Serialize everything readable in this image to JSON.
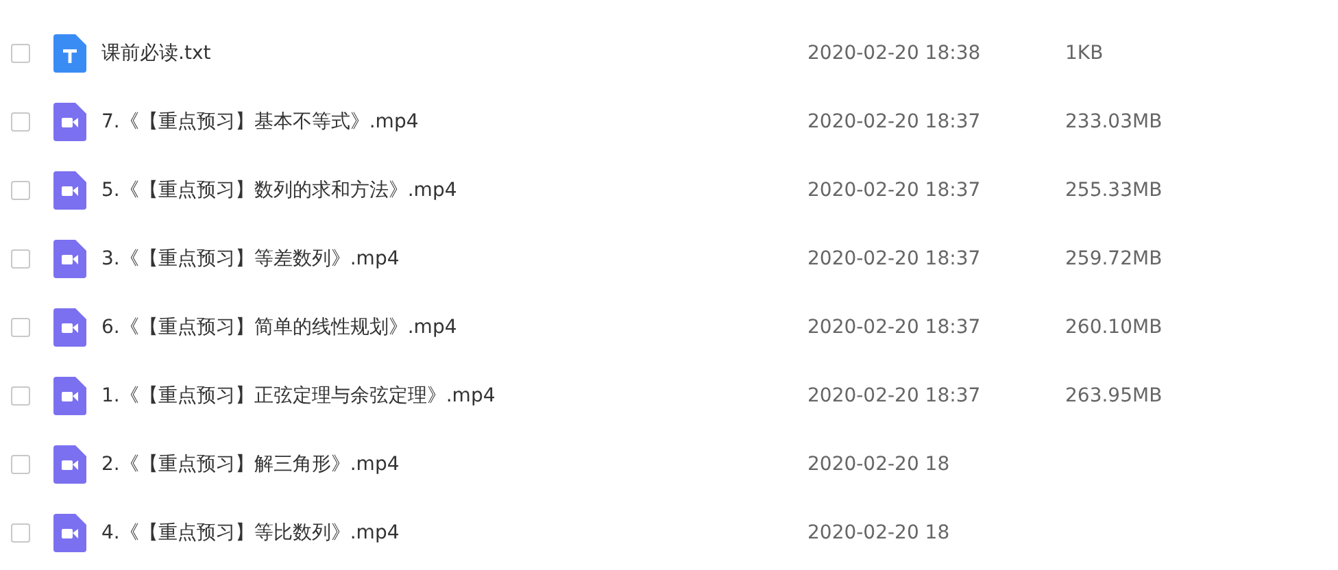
{
  "files": [
    {
      "kind": "txt",
      "checked": false,
      "name": "课前必读.txt",
      "date": "2020-02-20 18:38",
      "size": "1KB"
    },
    {
      "kind": "video",
      "checked": false,
      "name": "7.《【重点预习】基本不等式》.mp4",
      "date": "2020-02-20 18:37",
      "size": "233.03MB"
    },
    {
      "kind": "video",
      "checked": false,
      "name": "5.《【重点预习】数列的求和方法》.mp4",
      "date": "2020-02-20 18:37",
      "size": "255.33MB"
    },
    {
      "kind": "video",
      "checked": false,
      "name": "3.《【重点预习】等差数列》.mp4",
      "date": "2020-02-20 18:37",
      "size": "259.72MB"
    },
    {
      "kind": "video",
      "checked": false,
      "name": "6.《【重点预习】简单的线性规划》.mp4",
      "date": "2020-02-20 18:37",
      "size": "260.10MB"
    },
    {
      "kind": "video",
      "checked": false,
      "name": "1.《【重点预习】正弦定理与余弦定理》.mp4",
      "date": "2020-02-20 18:37",
      "size": "263.95MB"
    },
    {
      "kind": "video",
      "checked": false,
      "name": "2.《【重点预习】解三角形》.mp4",
      "date": "2020-02-20 18"
    },
    {
      "kind": "video",
      "checked": false,
      "name": "4.《【重点预习】等比数列》.mp4",
      "date": "2020-02-20 18"
    }
  ]
}
